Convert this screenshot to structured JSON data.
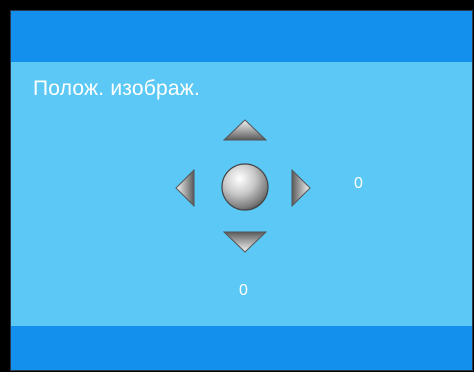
{
  "menu": {
    "title": "Полож. изображ."
  },
  "position": {
    "horizontal_value": "0",
    "vertical_value": "0"
  },
  "icons": {
    "up": "arrow-up-icon",
    "down": "arrow-down-icon",
    "left": "arrow-left-icon",
    "right": "arrow-right-icon",
    "center": "center-knob-icon"
  },
  "colors": {
    "background": "#5bc8f5",
    "bar": "#1390ee",
    "text": "#ffffff"
  }
}
